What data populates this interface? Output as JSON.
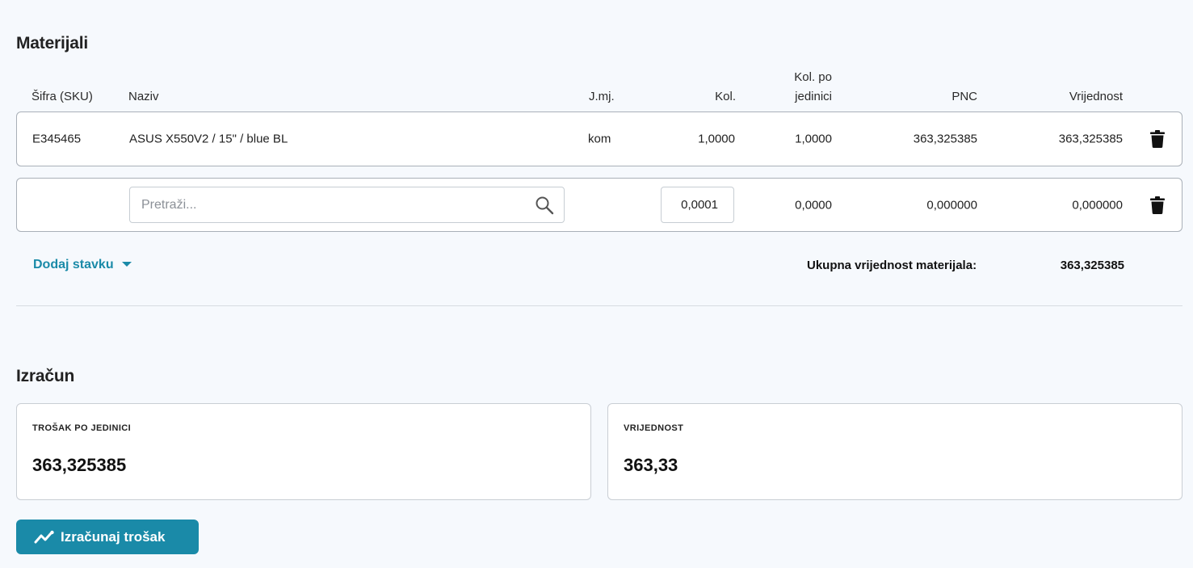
{
  "materials": {
    "title": "Materijali",
    "columns": {
      "sku": "Šifra (SKU)",
      "name": "Naziv",
      "unit": "J.mj.",
      "qty": "Kol.",
      "qty_per_unit_line1": "Kol. po",
      "qty_per_unit_line2": "jedinici",
      "pnc": "PNC",
      "value": "Vrijednost"
    },
    "rows": [
      {
        "sku": "E345465",
        "name": "ASUS X550V2 / 15\" / blue BL",
        "unit": "kom",
        "qty": "1,0000",
        "qty_per_unit": "1,0000",
        "pnc": "363,325385",
        "value": "363,325385",
        "icon": "trash-icon"
      }
    ],
    "new_row": {
      "search_placeholder": "Pretraži...",
      "search_icon": "search-icon",
      "qty": "0,0001",
      "qty_per_unit": "0,0000",
      "pnc": "0,000000",
      "value": "0,000000",
      "icon": "trash-icon"
    },
    "add_item_label": "Dodaj stavku",
    "add_item_icon": "caret-down-icon",
    "total_label": "Ukupna vrijednost materijala:",
    "total_value": "363,325385"
  },
  "calculation": {
    "title": "Izračun",
    "unit_cost": {
      "label": "TROŠAK PO JEDINICI",
      "value": "363,325385"
    },
    "value": {
      "label": "VRIJEDNOST",
      "value": "363,33"
    },
    "button_label": "Izračunaj trošak",
    "button_icon": "trend-line-icon"
  },
  "colors": {
    "accent": "#1a8aa8",
    "background": "#f6f9fd",
    "border": "#a9b0b8"
  }
}
